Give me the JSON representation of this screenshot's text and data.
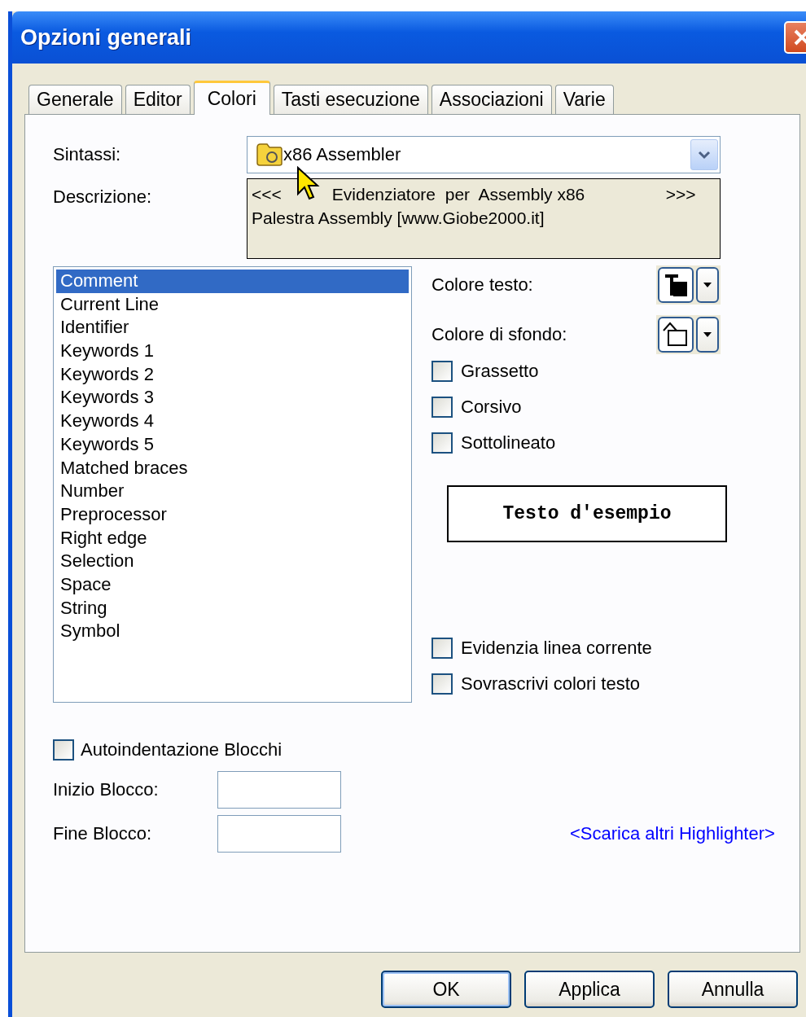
{
  "window": {
    "title": "Opzioni generali"
  },
  "tabs": [
    {
      "label": "Generale",
      "selected": false
    },
    {
      "label": "Editor",
      "selected": false
    },
    {
      "label": "Colori",
      "selected": true
    },
    {
      "label": "Tasti esecuzione",
      "selected": false
    },
    {
      "label": "Associazioni",
      "selected": false
    },
    {
      "label": "Varie",
      "selected": false
    }
  ],
  "syntax": {
    "label": "Sintassi:",
    "value": "x86 Assembler"
  },
  "description": {
    "label": "Descrizione:",
    "first_line": [
      "<<<",
      "Evidenziatore  per  Assembly x86",
      ">>>"
    ],
    "second_line": "Palestra Assembly [www.Giobe2000.it]"
  },
  "elements": [
    {
      "label": "Comment",
      "selected": true
    },
    {
      "label": "Current Line",
      "selected": false
    },
    {
      "label": "Identifier",
      "selected": false
    },
    {
      "label": "Keywords 1",
      "selected": false
    },
    {
      "label": "Keywords 2",
      "selected": false
    },
    {
      "label": "Keywords 3",
      "selected": false
    },
    {
      "label": "Keywords 4",
      "selected": false
    },
    {
      "label": "Keywords 5",
      "selected": false
    },
    {
      "label": "Matched braces",
      "selected": false
    },
    {
      "label": "Number",
      "selected": false
    },
    {
      "label": "Preprocessor",
      "selected": false
    },
    {
      "label": "Right edge",
      "selected": false
    },
    {
      "label": "Selection",
      "selected": false
    },
    {
      "label": "Space",
      "selected": false
    },
    {
      "label": "String",
      "selected": false
    },
    {
      "label": "Symbol",
      "selected": false
    }
  ],
  "text_color": {
    "label": "Colore testo:"
  },
  "background_color": {
    "label": "Colore di sfondo:"
  },
  "style_options": [
    {
      "label": "Grassetto",
      "checked": false
    },
    {
      "label": "Corsivo",
      "checked": false
    },
    {
      "label": "Sottolineato",
      "checked": false
    }
  ],
  "sample": "Testo d'esempio",
  "highlight_options": [
    {
      "label": "Evidenzia linea corrente",
      "checked": false
    },
    {
      "label": "Sovrascrivi colori testo",
      "checked": false
    }
  ],
  "auto_indent": {
    "label": "Autoindentazione Blocchi",
    "checked": false
  },
  "block_start": {
    "label": "Inizio Blocco:"
  },
  "block_end": {
    "label": "Fine Blocco:"
  },
  "download_link": "<Scarica altri Highlighter>",
  "buttons": [
    {
      "label": "OK",
      "default": true
    },
    {
      "label": "Applica",
      "default": false
    },
    {
      "label": "Annulla",
      "default": false
    }
  ]
}
